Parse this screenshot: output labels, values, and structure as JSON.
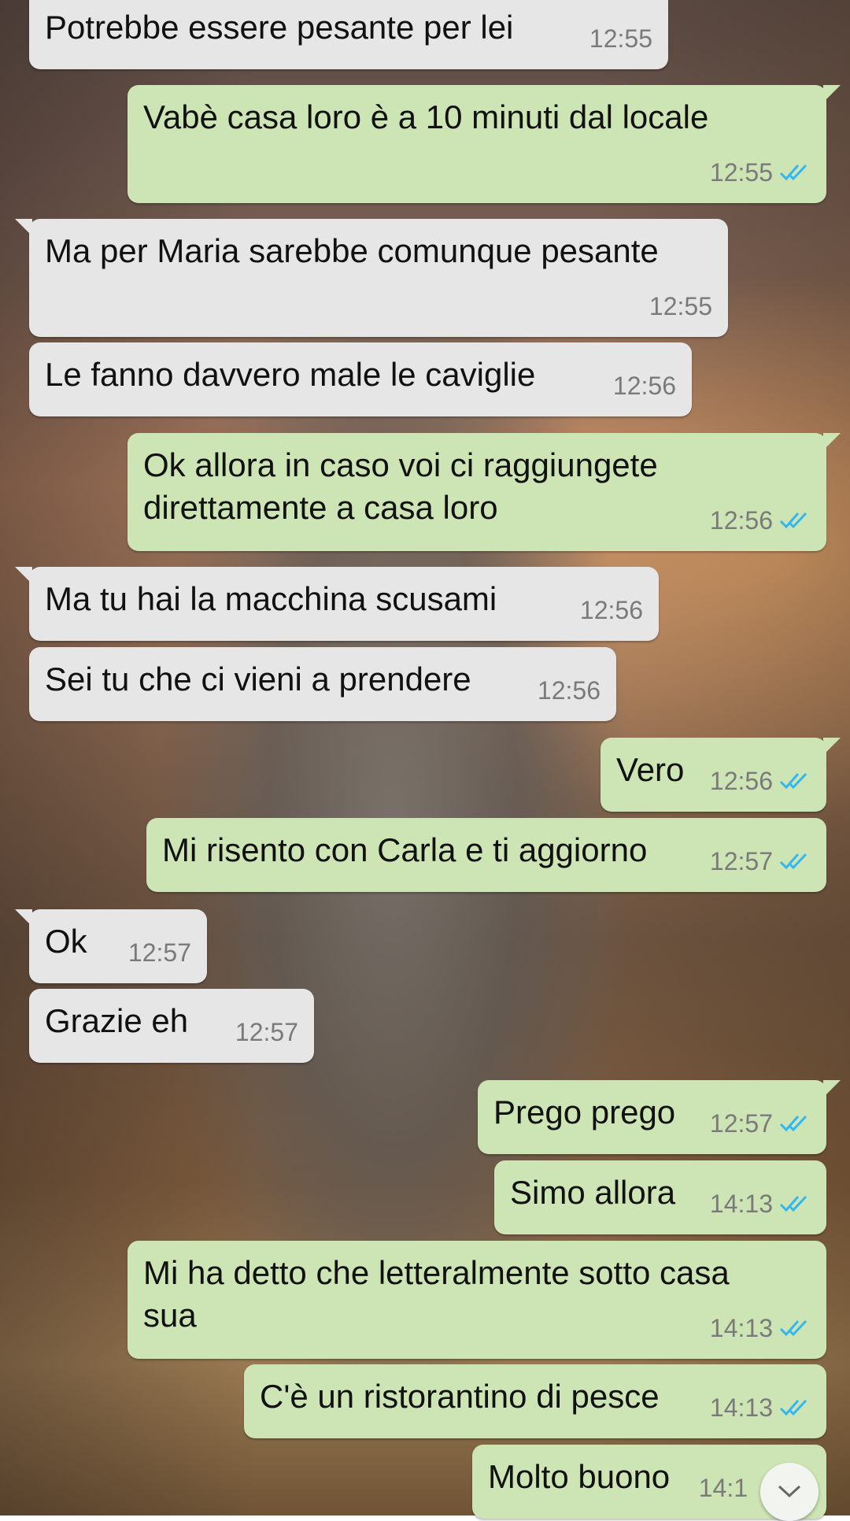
{
  "colors": {
    "incoming_bubble": "#e6e6e6",
    "outgoing_bubble": "#cde4b4",
    "timestamp": "#7a7a7a",
    "read_ticks": "#34b7f1"
  },
  "messages": [
    {
      "dir": "in",
      "text": "Potrebbe essere pesante per lei",
      "time": "12:55"
    },
    {
      "dir": "out",
      "text": "Vabè casa loro è a 10 minuti dal locale",
      "time": "12:55",
      "status": "read"
    },
    {
      "dir": "in",
      "text": "Ma per Maria sarebbe comunque pesante",
      "time": "12:55"
    },
    {
      "dir": "in",
      "text": "Le fanno davvero male le caviglie",
      "time": "12:56"
    },
    {
      "dir": "out",
      "text": "Ok allora in caso voi ci raggiungete\ndirettamente a casa loro",
      "time": "12:56",
      "status": "read"
    },
    {
      "dir": "in",
      "text": "Ma tu hai la macchina scusami",
      "time": "12:56"
    },
    {
      "dir": "in",
      "text": "Sei tu che ci vieni a prendere",
      "time": "12:56"
    },
    {
      "dir": "out",
      "text": "Vero",
      "time": "12:56",
      "status": "read"
    },
    {
      "dir": "out",
      "text": "Mi risento con Carla e ti aggiorno",
      "time": "12:57",
      "status": "read"
    },
    {
      "dir": "in",
      "text": "Ok",
      "time": "12:57"
    },
    {
      "dir": "in",
      "text": "Grazie eh",
      "time": "12:57"
    },
    {
      "dir": "out",
      "text": "Prego prego",
      "time": "12:57",
      "status": "read"
    },
    {
      "dir": "out",
      "text": "Simo allora",
      "time": "14:13",
      "status": "read"
    },
    {
      "dir": "out",
      "text": "Mi ha detto che letteralmente sotto casa\nsua",
      "time": "14:13",
      "status": "read"
    },
    {
      "dir": "out",
      "text": "C'è un ristorantino di pesce",
      "time": "14:13",
      "status": "read"
    },
    {
      "dir": "out",
      "text": "Molto buono",
      "time": "14:1",
      "status": "read"
    }
  ],
  "scroll_button": {
    "icon": "chevron-down-icon"
  }
}
